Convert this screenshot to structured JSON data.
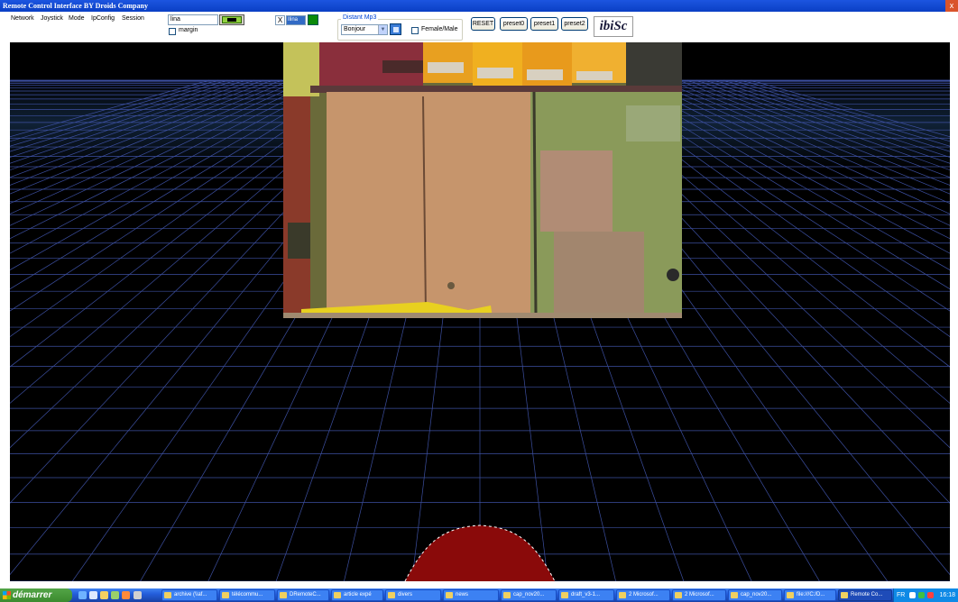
{
  "window": {
    "title": "Remote Control Interface BY Droids Company",
    "close_glyph": "x"
  },
  "menu": [
    "Network",
    "Joystick",
    "Mode",
    "IpConfig",
    "Session"
  ],
  "controls": {
    "name_value": "lina",
    "margin_label": "margin",
    "x_glyph": "X",
    "selected_field_value": "Ilina",
    "distant_mp3_label": "Distant Mp3",
    "mp3_selected": "Bonjour",
    "female_male_label": "Female/Male",
    "reset_label": "RESET",
    "preset0_label": "preset0",
    "preset1_label": "preset1",
    "preset2_label": "preset2",
    "logo_text": "ibiSc"
  },
  "taskbar": {
    "start_label": "démarrer",
    "tasks": [
      "archive (\\\\af...",
      "télécommu...",
      "DRemoteC...",
      "article expé",
      "divers",
      "news",
      "cap_nov20...",
      "draft_v3-1...",
      "2 Microsof...",
      "2 Microsof...",
      "cap_nov20...",
      "file:///C:/D...",
      "Remote Co..."
    ],
    "language": "FR",
    "clock": "16:18"
  },
  "colors": {
    "accent": "#0a3fc4",
    "grid": "#3c4fa0",
    "robot": "#8a0a0a",
    "status_green": "#0a8a0a"
  }
}
